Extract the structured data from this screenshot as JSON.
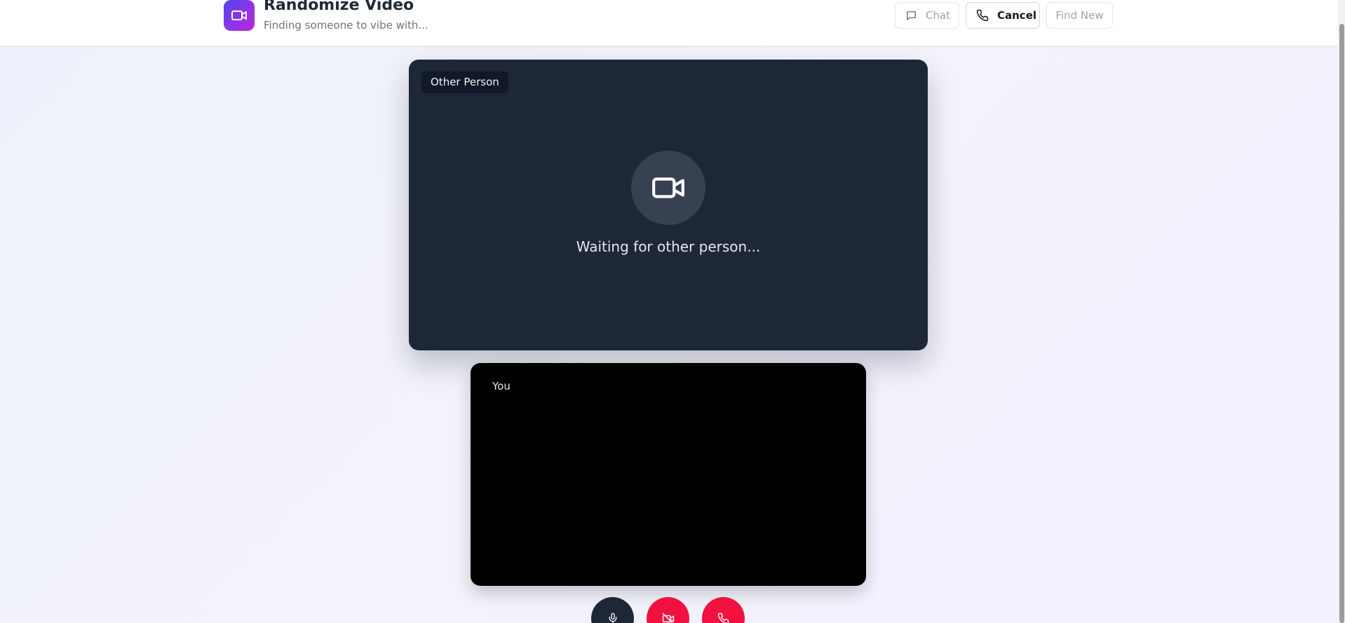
{
  "header": {
    "title": "Randomize Video",
    "subtitle": "Finding someone to vibe with...",
    "logo_icon": "video-camera-icon",
    "buttons": {
      "chat_label": "Chat",
      "cancel_label": "Cancel",
      "find_new_label": "Find New"
    }
  },
  "remote": {
    "label": "Other Person",
    "status": "Waiting for other person...",
    "icon": "video-camera-icon"
  },
  "local": {
    "label": "You"
  },
  "controls": {
    "mic_icon": "microphone-icon",
    "camera_icon": "camera-off-icon",
    "end_call_icon": "phone-icon"
  },
  "colors": {
    "accent_start": "#4f46e5",
    "accent_end": "#c026d3",
    "danger": "#f0113e",
    "video_bg": "#1e2738"
  }
}
